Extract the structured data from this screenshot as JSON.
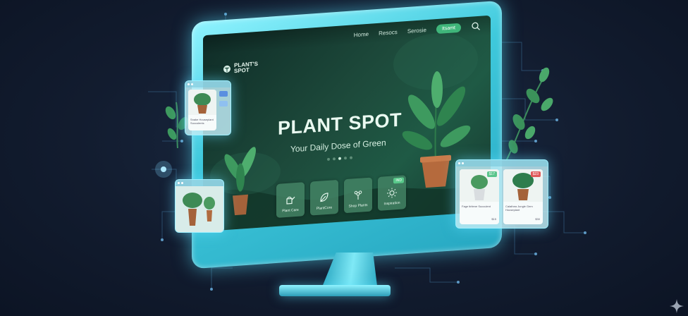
{
  "nav": {
    "links": [
      "Home",
      "Resocs",
      "Serosie"
    ],
    "cta_label": "Itsamt",
    "search_icon": "search-icon"
  },
  "brand": {
    "logo_text_line1": "PLANT'S",
    "logo_text_line2": "SPOT"
  },
  "hero": {
    "title": "PLANT SPOT",
    "subtitle": "Your Daily Dose of Green",
    "carousel_dots": 5,
    "active_dot": 2
  },
  "feature_cards": [
    {
      "label": "Plant Care",
      "icon": "watering-can-icon",
      "badge": ""
    },
    {
      "label": "PlantCore",
      "icon": "leaf-icon",
      "badge": ""
    },
    {
      "label": "Shop Plants",
      "icon": "flower-icon",
      "badge": ""
    },
    {
      "label": "Inspiration",
      "icon": "sun-icon",
      "badge": "IND"
    }
  ],
  "floating_panels": {
    "top_left": {
      "caption": "Snake Houseplant Succulents",
      "tags": [
        "",
        ""
      ]
    },
    "right": {
      "items": [
        {
          "name": "Fage tiritene Succulent",
          "price": "$17",
          "price_text": "$15"
        },
        {
          "name": "Calathea Jungle Gem Houseplant",
          "price": "$23",
          "price_text": "$30"
        }
      ]
    }
  },
  "colors": {
    "accent": "#3fb57a",
    "monitor_frame": "#3fc9dc",
    "background": "#121c2f",
    "screen": "#1d4a3b"
  }
}
